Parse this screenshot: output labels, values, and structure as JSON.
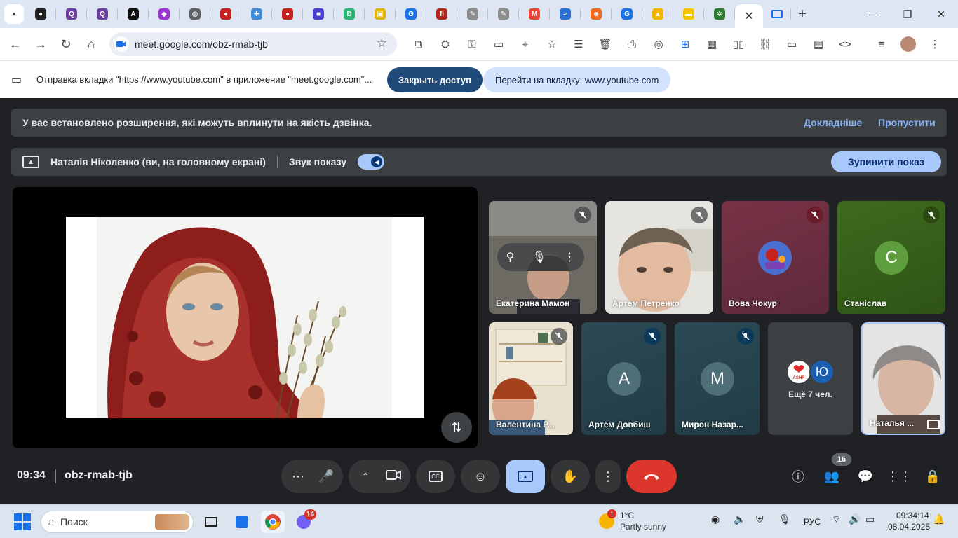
{
  "browser": {
    "url": "meet.google.com/obz-rmab-tjb",
    "active_tab_close": "✕",
    "new_tab": "+",
    "tab_favicons": [
      {
        "icon": "tab-favicon-circle",
        "color": "#1f1f1f",
        "glyph": "●"
      },
      {
        "icon": "tab-favicon-q",
        "color": "#6b3fa0",
        "glyph": "Q"
      },
      {
        "icon": "tab-favicon-q",
        "color": "#6b3fa0",
        "glyph": "Q"
      },
      {
        "icon": "tab-favicon-a",
        "color": "#111111",
        "glyph": "A"
      },
      {
        "icon": "tab-favicon-hex",
        "color": "#9b36d3",
        "glyph": "◆"
      },
      {
        "icon": "tab-favicon-globe",
        "color": "#5f6368",
        "glyph": "◍"
      },
      {
        "icon": "tab-favicon-red-ball",
        "color": "#c5221f",
        "glyph": "●"
      },
      {
        "icon": "tab-favicon-puzzle",
        "color": "#3d8bd9",
        "glyph": "✚"
      },
      {
        "icon": "tab-favicon-red-ball",
        "color": "#c5221f",
        "glyph": "●"
      },
      {
        "icon": "tab-favicon-square",
        "color": "#4b3fd1",
        "glyph": "■"
      },
      {
        "icon": "tab-favicon-d",
        "color": "#2bb673",
        "glyph": "D"
      },
      {
        "icon": "tab-favicon-image",
        "color": "#e0b400",
        "glyph": "▣"
      },
      {
        "icon": "tab-favicon-g",
        "color": "#1a73e8",
        "glyph": "G"
      },
      {
        "icon": "tab-favicon-fi",
        "color": "#b3261e",
        "glyph": "fi"
      },
      {
        "icon": "tab-favicon-pencil",
        "color": "#8d8d8d",
        "glyph": "✎"
      },
      {
        "icon": "tab-favicon-pencil",
        "color": "#8d8d8d",
        "glyph": "✎"
      },
      {
        "icon": "tab-favicon-gmail",
        "color": "#ea4335",
        "glyph": "M"
      },
      {
        "icon": "tab-favicon-wave",
        "color": "#2a6fd1",
        "glyph": "≈"
      },
      {
        "icon": "tab-favicon-orange",
        "color": "#f26b1d",
        "glyph": "☻"
      },
      {
        "icon": "tab-favicon-g",
        "color": "#1a73e8",
        "glyph": "G"
      },
      {
        "icon": "tab-favicon-bell",
        "color": "#f4b400",
        "glyph": "▲"
      },
      {
        "icon": "tab-favicon-flag",
        "color": "#f4c400",
        "glyph": "▬"
      },
      {
        "icon": "tab-favicon-dots",
        "color": "#2e7d32",
        "glyph": "✲"
      }
    ]
  },
  "share_bar": {
    "message": "Отправка вкладки \"https://www.youtube.com\" в приложение \"meet.google.com\"...",
    "close_access": "Закрыть доступ",
    "goto_tab": "Перейти на вкладку: www.youtube.com"
  },
  "banner": {
    "text": "У вас встановлено розширення, які можуть вплинути на якість дзвінка.",
    "details": "Докладніше",
    "skip": "Пропустити"
  },
  "presenting": {
    "name": "Наталія Ніколенко (ви, на головному екрані)",
    "sound_label": "Звук показу",
    "sound_on": true,
    "stop": "Зупинити показ"
  },
  "participants": [
    {
      "name": "Екатерина Мамон",
      "muted": true,
      "kind": "video"
    },
    {
      "name": "Артем Петренко",
      "muted": true,
      "kind": "video"
    },
    {
      "name": "Вова Чокур",
      "muted": true,
      "kind": "avatar-image"
    },
    {
      "name": "Станіслав",
      "muted": true,
      "kind": "letter",
      "letter": "С",
      "color": "#5f9e3f"
    },
    {
      "name": "Валентина Р...",
      "muted": true,
      "kind": "video"
    },
    {
      "name": "Артем Довбиш",
      "muted": true,
      "kind": "letter",
      "letter": "А",
      "color": "#4f6f78"
    },
    {
      "name": "Мирон Назар...",
      "muted": true,
      "kind": "letter",
      "letter": "М",
      "color": "#4f6f78"
    },
    {
      "name": "Наталья ...",
      "muted": false,
      "kind": "video-self"
    }
  ],
  "others": {
    "label": "Ещё 7 чел.",
    "letter": "Ю",
    "letter_color": "#1a5fb4",
    "avatar_text": "ASHR"
  },
  "bottom": {
    "time": "09:34",
    "code": "obz-rmab-tjb",
    "people_count": "16"
  },
  "taskbar": {
    "search": "Поиск",
    "viber_badge": "14",
    "weather_badge": "1",
    "temp": "1°C",
    "weather": "Partly sunny",
    "lang": "РУС",
    "time": "09:34:14",
    "date": "08.04.2025"
  }
}
